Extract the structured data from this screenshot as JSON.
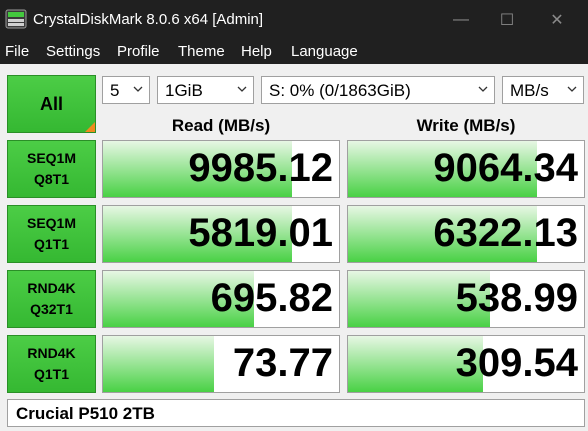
{
  "window": {
    "title": "CrystalDiskMark 8.0.6 x64 [Admin]",
    "controls": {
      "minimize": "—",
      "maximize": "☐",
      "close": "✕"
    }
  },
  "menu": [
    "File",
    "Settings",
    "Profile",
    "Theme",
    "Help",
    "Language"
  ],
  "toolbar": {
    "all_label": "All",
    "count": "5",
    "size": "1GiB",
    "drive": "S: 0% (0/1863GiB)",
    "unit": "MB/s"
  },
  "headers": {
    "read": "Read (MB/s)",
    "write": "Write (MB/s)"
  },
  "tests": [
    {
      "line1": "SEQ1M",
      "line2": "Q8T1",
      "read": "9985.12",
      "write": "9064.34",
      "read_fill": 0.8,
      "write_fill": 0.8
    },
    {
      "line1": "SEQ1M",
      "line2": "Q1T1",
      "read": "5819.01",
      "write": "6322.13",
      "read_fill": 0.8,
      "write_fill": 0.8
    },
    {
      "line1": "RND4K",
      "line2": "Q32T1",
      "read": "695.82",
      "write": "538.99",
      "read_fill": 0.64,
      "write_fill": 0.6
    },
    {
      "line1": "RND4K",
      "line2": "Q1T1",
      "read": "73.77",
      "write": "309.54",
      "read_fill": 0.47,
      "write_fill": 0.57
    }
  ],
  "comment": "Crucial P510 2TB",
  "colors": {
    "accent_green": "#3fc43b",
    "bar_green": "#49d145",
    "title_bg": "#202020",
    "corner_orange": "#f08a1e"
  },
  "icons": [
    "app-icon",
    "chevron-down-icon"
  ]
}
